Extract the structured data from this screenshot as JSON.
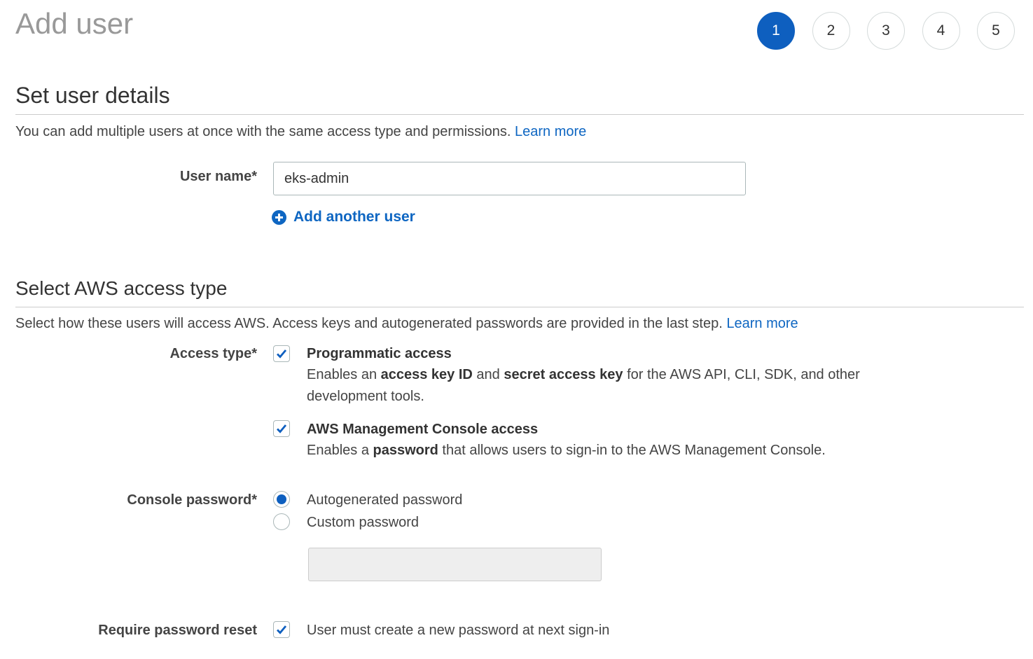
{
  "page": {
    "title": "Add user"
  },
  "steps": [
    "1",
    "2",
    "3",
    "4",
    "5"
  ],
  "user_details": {
    "title": "Set user details",
    "description": "You can add multiple users at once with the same access type and permissions.",
    "learn_more": "Learn more",
    "user_name_label": "User name*",
    "user_name_value": "eks-admin",
    "add_another_user": "Add another user"
  },
  "access": {
    "title": "Select AWS access type",
    "description": "Select how these users will access AWS. Access keys and autogenerated passwords are provided in the last step.",
    "learn_more": "Learn more",
    "access_type_label": "Access type*",
    "programmatic": {
      "title": "Programmatic access",
      "desc_1": "Enables an ",
      "desc_bold_1": "access key ID",
      "desc_2": " and ",
      "desc_bold_2": "secret access key",
      "desc_3": " for the AWS API, CLI, SDK, and other development tools.",
      "checked": true
    },
    "console": {
      "title": "AWS Management Console access",
      "desc_1": "Enables a ",
      "desc_bold_1": "password",
      "desc_2": " that allows users to sign-in to the AWS Management Console.",
      "checked": true
    },
    "console_password_label": "Console password*",
    "autogenerated": "Autogenerated password",
    "custom": "Custom password",
    "selected_password_option": "Autogenerated password",
    "require_reset_label": "Require password reset",
    "require_reset_text": "User must create a new password at next sign-in",
    "require_reset_checked": true
  },
  "colors": {
    "accent": "#0e5fbf",
    "link": "#0e66c2",
    "title_gray": "#999999"
  }
}
